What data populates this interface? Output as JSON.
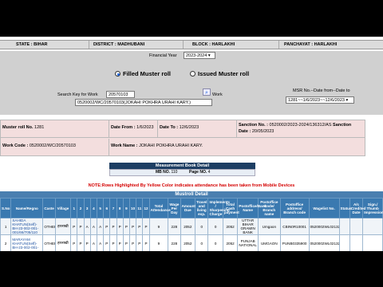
{
  "location": {
    "state": "STATE : BIHAR",
    "district": "DISTRICT : MADHUBANI",
    "block": "BLOCK : HARLAKHI",
    "panchayat": "PANCHAYAT : HARLAKHI"
  },
  "form": {
    "fy_label": "Financial Year",
    "fy_value": "2023-2024",
    "radio_filled": "Filled Muster roll",
    "radio_issued": "Issued Muster roll",
    "search_label": "Search Key for Work",
    "search_value": "20570103",
    "work_label": "Work",
    "work_value": "0520002/WC/20570103(JOKAHI POKHRA URAHI KARY.)",
    "msr_label": "MSR No.--Date from--Date to",
    "msr_value": "1281~~1/6/2023~~12/6/2023"
  },
  "info": {
    "muster_label": "Muster roll No.",
    "muster_value": "1281",
    "date_from_label": "Date From :",
    "date_from_value": "1/6/2023",
    "date_to_label": "Date To :",
    "date_to_value": "12/6/2023",
    "sanction_no_label": "Sanction No. :",
    "sanction_no_value": "0520002/2023-2024/136312/AS",
    "sanction_label": "Sanction",
    "sanction_date_label": "Date :",
    "sanction_date_value": "20/05/2023",
    "work_code_label": "Work Code :",
    "work_code_value": "0520002/WC/20570103",
    "work_name_label": "Work Name :",
    "work_name_value": "JOKAHI POKHRA URAHI KARY."
  },
  "measurement": {
    "title": "Measurement Book Detail",
    "mb_label": "MB NO.",
    "mb_value": "110",
    "page_label": "Page NO.",
    "page_value": "4"
  },
  "note": "NOTE:Rows Highlighted By Yellow Color indicates attendance has been taken from Mobile Devices",
  "mustroll": {
    "title": "Mustroll Detail",
    "headers": [
      "S.No",
      "Name/Regno",
      "Caste",
      "Village",
      "1",
      "2",
      "3",
      "4",
      "5",
      "6",
      "7",
      "8",
      "9",
      "10",
      "11",
      "12",
      "Total Attendance",
      "Wage Per Day",
      "Amount Due",
      "Travel and living exp.",
      "Implements / Sharpening Charge",
      "Total Cash payment",
      "Postoffice/Bank Name",
      "Postoffice Code/ Branch name",
      "Postoffice address/ Branch code",
      "Wagelist No.",
      "Status",
      "A/c Credited Date",
      "Sign./ Thumb Impression"
    ],
    "rows": [
      [
        "1",
        "SAHIDA KHATUN(Self)-BH-23-002-001-001/66/705/110",
        "OTHER",
        "हरलाखी",
        "P",
        "P",
        "A",
        "A",
        "A",
        "P",
        "P",
        "P",
        "P",
        "P",
        "P",
        "P",
        "9",
        "228",
        "2052",
        "0",
        "0",
        "2052",
        "UTTAR BIHAR GRAMIN BANK",
        "Umgaon",
        "CBIN0R10001",
        "0520002WL02132A",
        "",
        "",
        ""
      ],
      [
        "2",
        "MARAYAM KHATUN(Self)-BH-23-002-001-",
        "OTHER",
        "हरलाखी",
        "P",
        "P",
        "P",
        "A",
        "A",
        "P",
        "P",
        "P",
        "P",
        "P",
        "P",
        "P",
        "9",
        "228",
        "2052",
        "0",
        "0",
        "2052",
        "PUNJAB NATIONAL",
        "UMGAON",
        "PUNB0335900",
        "0520002WL02132A",
        "",
        "",
        ""
      ]
    ]
  }
}
